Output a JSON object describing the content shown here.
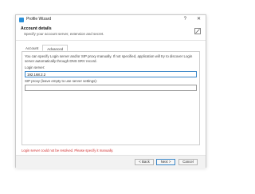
{
  "window": {
    "title": "Profile Wizard",
    "help_label": "?",
    "close_label": "✕"
  },
  "header": {
    "title": "Account details",
    "subtitle": "Specify your account server, extension and secret."
  },
  "tabs": [
    {
      "label": "Account",
      "active": false
    },
    {
      "label": "Advanced",
      "active": true
    }
  ],
  "advanced": {
    "description": "You can specify Login server and/or SIP proxy manually. If not specified, application will try to discover Login server automatically through DNS SRV record.",
    "login_server_label": "Login server:",
    "login_server_value": "192.168.2.2",
    "sip_proxy_label": "SIP proxy (leave empty to use server settings):",
    "sip_proxy_value": ""
  },
  "error_message": "Login server could not be resolved. Please specify it manually.",
  "buttons": {
    "back": "< Back",
    "next": "Next >",
    "cancel": "Cancel"
  },
  "colors": {
    "accent": "#3b87c8",
    "error": "#d03030"
  }
}
